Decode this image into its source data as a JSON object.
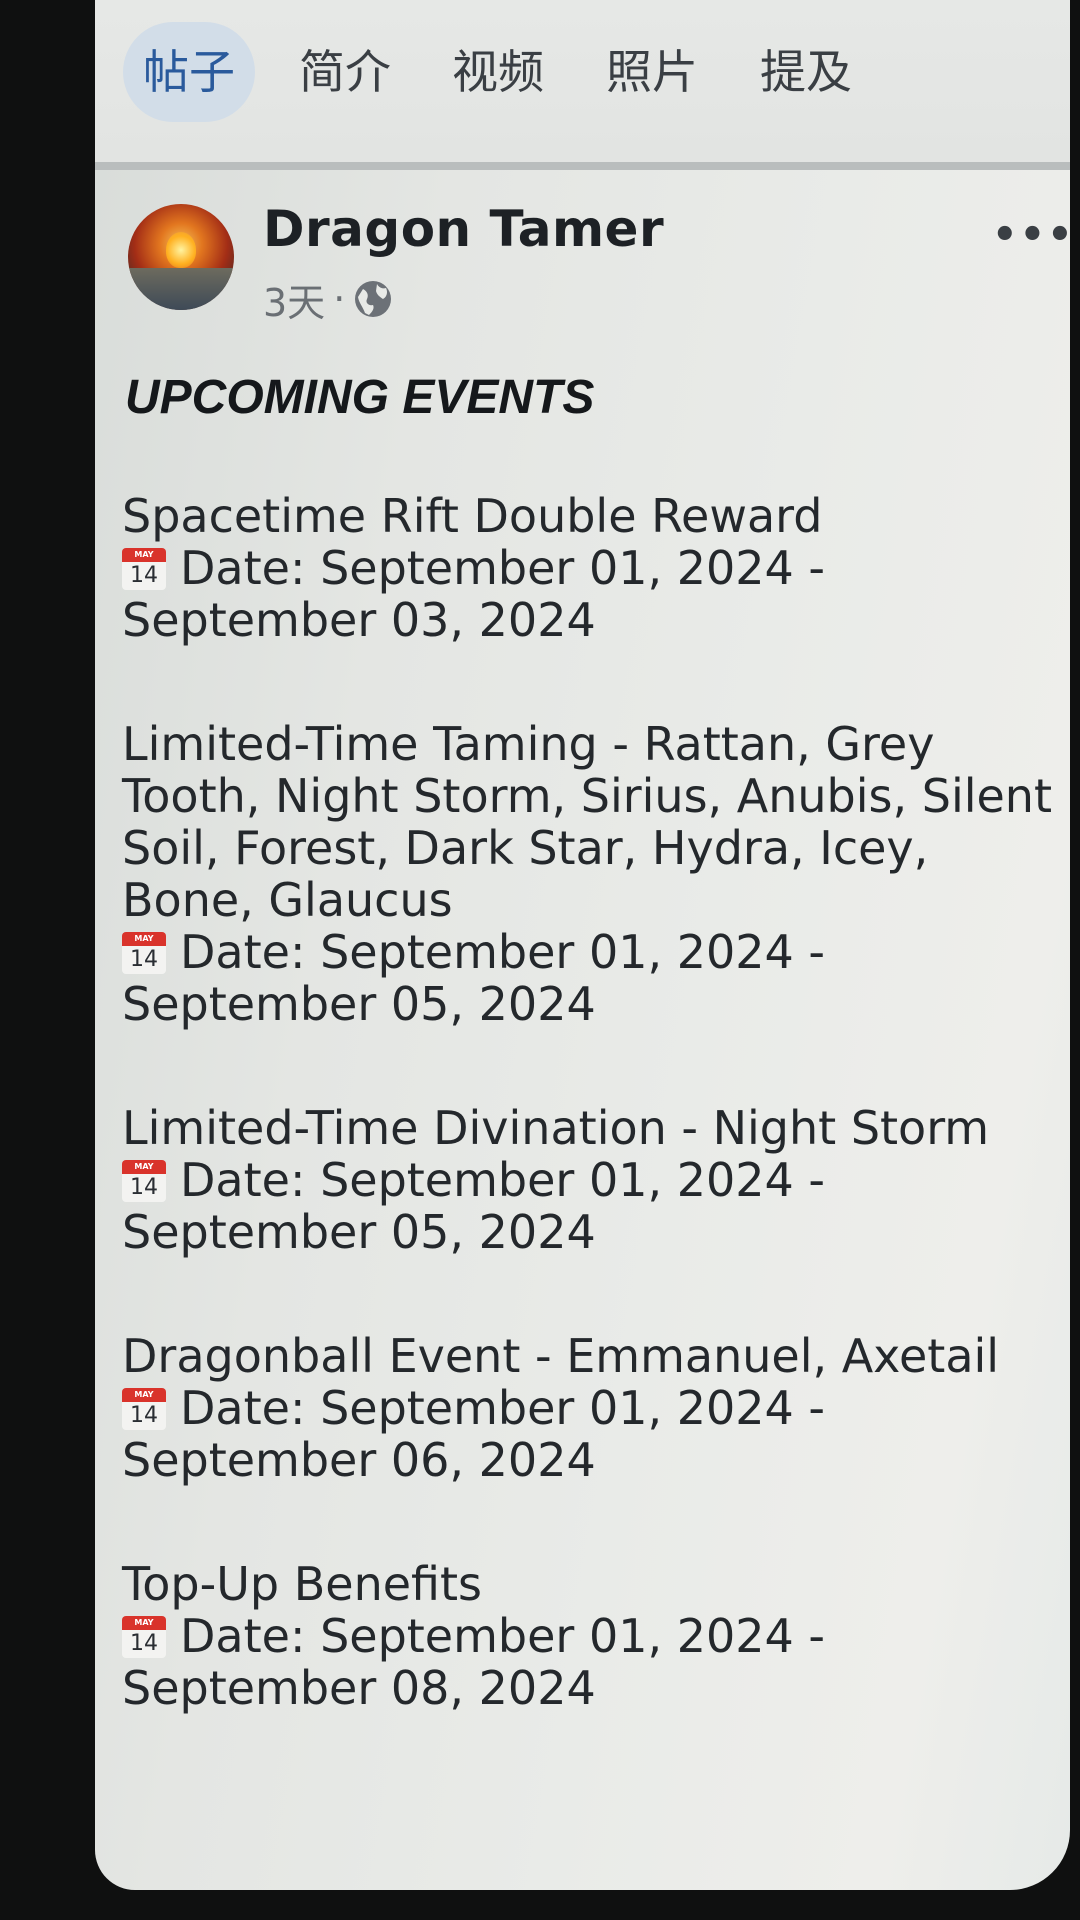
{
  "tabs": [
    {
      "label": "帖子",
      "active": true
    },
    {
      "label": "简介",
      "active": false
    },
    {
      "label": "视频",
      "active": false
    },
    {
      "label": "照片",
      "active": false
    },
    {
      "label": "提及",
      "active": false
    }
  ],
  "post": {
    "author": "Dragon Tamer",
    "time": "3天",
    "separator": "·",
    "privacy_icon": "globe-icon",
    "more_label": "•••",
    "heading": "UPCOMING EVENTS",
    "calendar_icon": {
      "name": "calendar-icon",
      "month": "MAY",
      "day": "14"
    },
    "events": [
      {
        "title": "Spacetime Rift Double Reward",
        "date": "Date: September 01, 2024 - September 03, 2024"
      },
      {
        "title": "Limited-Time Taming - Rattan, Grey Tooth, Night Storm, Sirius, Anubis, Silent Soil, Forest, Dark Star, Hydra, Icey, Bone, Glaucus",
        "date": "Date: September 01, 2024 - September 05, 2024"
      },
      {
        "title": "Limited-Time Divination - Night Storm",
        "date": "Date: September 01, 2024 - September 05, 2024"
      },
      {
        "title": "Dragonball Event - Emmanuel, Axetail",
        "date": "Date: September 01, 2024 - September 06, 2024"
      },
      {
        "title": "Top-Up Benefits",
        "date": "Date: September 01, 2024 - September 08, 2024"
      }
    ]
  },
  "colors": {
    "active_tab_bg": "#d2dde8",
    "active_tab_text": "#2a5a9c",
    "calendar_red": "#d9332b"
  }
}
